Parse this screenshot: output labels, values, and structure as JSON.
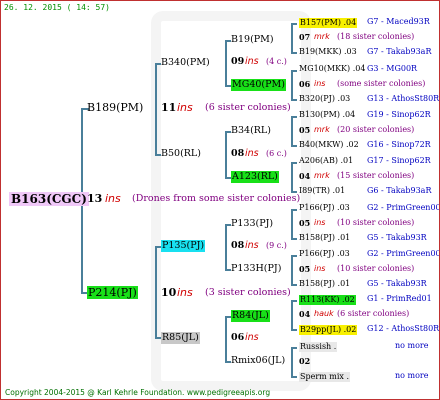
{
  "header": {
    "date": "26. 12. 2015 ( 14: 57)"
  },
  "footer": {
    "copyright": "Copyright 2004-2015 @ Karl Kehrle Foundation.   www.pedigreeapis.org"
  },
  "gen1": {
    "name": "B163(CGC)",
    "year": "13",
    "ins": "ins",
    "note": "(Drones from some sister colonies)"
  },
  "gen2": [
    {
      "name": "B189(PM)",
      "year": "11",
      "ins": "ins",
      "note": "(6 sister colonies)"
    },
    {
      "name": "P214(PJ)",
      "year": "10",
      "ins": "ins",
      "note": "(3 sister colonies)"
    }
  ],
  "gen3": [
    {
      "name": "B340(PM)"
    },
    {
      "name": "B50(RL)"
    },
    {
      "name": "P135(PJ)"
    },
    {
      "name": "R85(JL)"
    }
  ],
  "gen4": [
    {
      "name": "B19(PM)",
      "year": "09",
      "ins": "ins",
      "note": "(4 c.)"
    },
    {
      "name": "MG40(PM)"
    },
    {
      "name": "B34(RL)",
      "year": "08",
      "ins": "ins",
      "note": "(6 c.)"
    },
    {
      "name": "A123(RL)"
    },
    {
      "name": "P133(PJ)",
      "year": "08",
      "ins": "ins",
      "note": "(9 c.)"
    },
    {
      "name": "P133H(PJ)"
    },
    {
      "name": "R84(JL)",
      "year": "06",
      "ins": "ins"
    },
    {
      "name": "Rmix06(JL)"
    }
  ],
  "gen5": [
    {
      "top": "B157(PM) .04",
      "top_tail": "G7 - Maced93R",
      "year": "07",
      "ins": "mrk",
      "note": "(18 sister colonies)",
      "bottom": "B19(MKK) .03",
      "bottom_tail": "G7 - Takab93aR"
    },
    {
      "top": "MG10(MKK) .04",
      "top_tail": "G3 - MG00R",
      "year": "06",
      "ins": "ins",
      "note": "(some sister colonies)",
      "bottom": "B320(PJ) .03",
      "bottom_tail": "G13 - AthosSt80R"
    },
    {
      "top": "B130(PM) .04",
      "top_tail": "G19 - Sinop62R",
      "year": "05",
      "ins": "mrk",
      "note": "(20 sister colonies)",
      "bottom": "B40(MKW) .02",
      "bottom_tail": "G16 - Sinop72R"
    },
    {
      "top": "A206(AB) .01",
      "top_tail": "G17 - Sinop62R",
      "year": "04",
      "ins": "mrk",
      "note": "(15 sister colonies)",
      "bottom": "I89(TR) .01",
      "bottom_tail": "G6 - Takab93aR"
    },
    {
      "top": "P166(PJ) .03",
      "top_tail": "G2 - PrimGreen00",
      "year": "05",
      "ins": "ins",
      "note": "(10 sister colonies)",
      "bottom": "B158(PJ) .01",
      "bottom_tail": "G5 - Takab93R"
    },
    {
      "top": "P166(PJ) .03",
      "top_tail": "G2 - PrimGreen00",
      "year": "05",
      "ins": "ins",
      "note": "(10 sister colonies)",
      "bottom": "B158(PJ) .01",
      "bottom_tail": "G5 - Takab93R"
    },
    {
      "top": "R113(KK) .02",
      "top_tail": "G1 - PrimRed01",
      "year": "04",
      "ins": "hauk",
      "note": "(6 sister colonies)",
      "bottom": "B29pp(JL) .02",
      "bottom_tail": "G12 - AthosSt80R"
    },
    {
      "top": "Russish .",
      "top_tail": "no more",
      "year": "02",
      "ins": "",
      "note": "",
      "bottom": "Sperm mix .",
      "bottom_tail": "no more"
    }
  ],
  "colors": {
    "line": "#4a7f9a",
    "ins": "#d00000",
    "header": "#009000",
    "highlight_yellow": "#f8f000",
    "highlight_green": "#18e018",
    "highlight_cyan": "#18e0f0"
  }
}
